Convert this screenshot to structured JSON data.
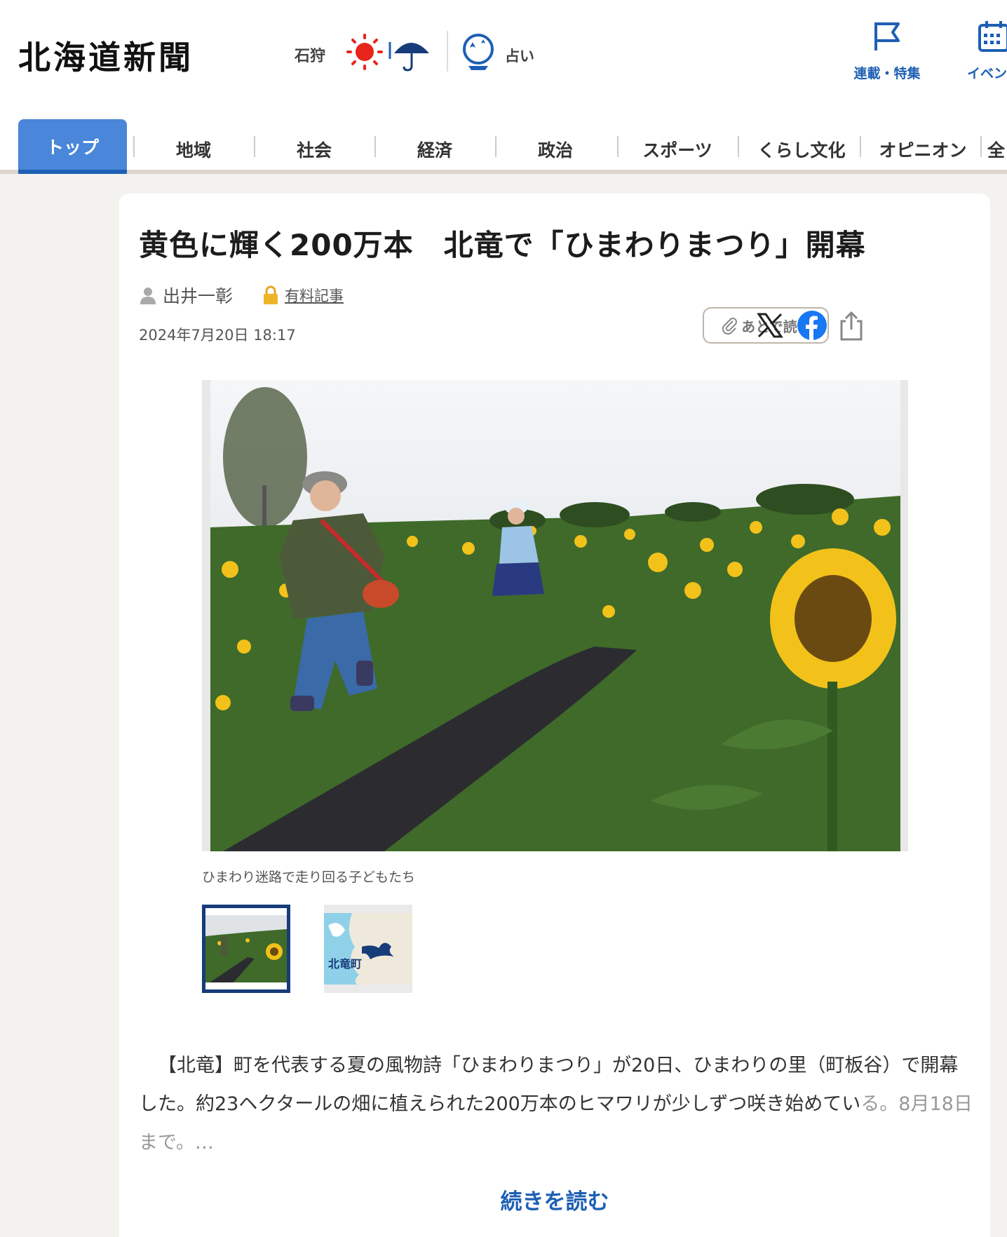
{
  "header": {
    "logo": "北海道新聞",
    "region": "石狩",
    "fortune_label": "占い",
    "links": [
      {
        "label": "連載・特集"
      },
      {
        "label": "イベント"
      }
    ]
  },
  "nav": {
    "items": [
      "トップ",
      "地域",
      "社会",
      "経済",
      "政治",
      "スポーツ",
      "くらし文化",
      "オピニオン",
      "全"
    ]
  },
  "article": {
    "title": "黄色に輝く200万本　北竜で「ひまわりまつり」開幕",
    "author": "出井一彰",
    "paid_label": "有料記事",
    "date": "2024年7月20日 18:17",
    "read_later": "あとで読む",
    "photo_caption": "ひまわり迷路で走り回る子どもたち",
    "map_label": "北竜町",
    "body_visible": "【北竜】町を代表する夏の風物詩「ひまわりまつり」が20日、ひまわりの里（町板谷）で開幕した。約23ヘクタールの畑に植えられた200万本のヒマワリが少しずつ咲き始めてい",
    "body_faded": "る。8月18日まで。…",
    "read_more": "続きを読む"
  },
  "colors": {
    "brand_blue": "#1d5fb4",
    "nav_active": "#4a86d9",
    "facebook": "#1877f2",
    "sun_red": "#e8241b"
  }
}
